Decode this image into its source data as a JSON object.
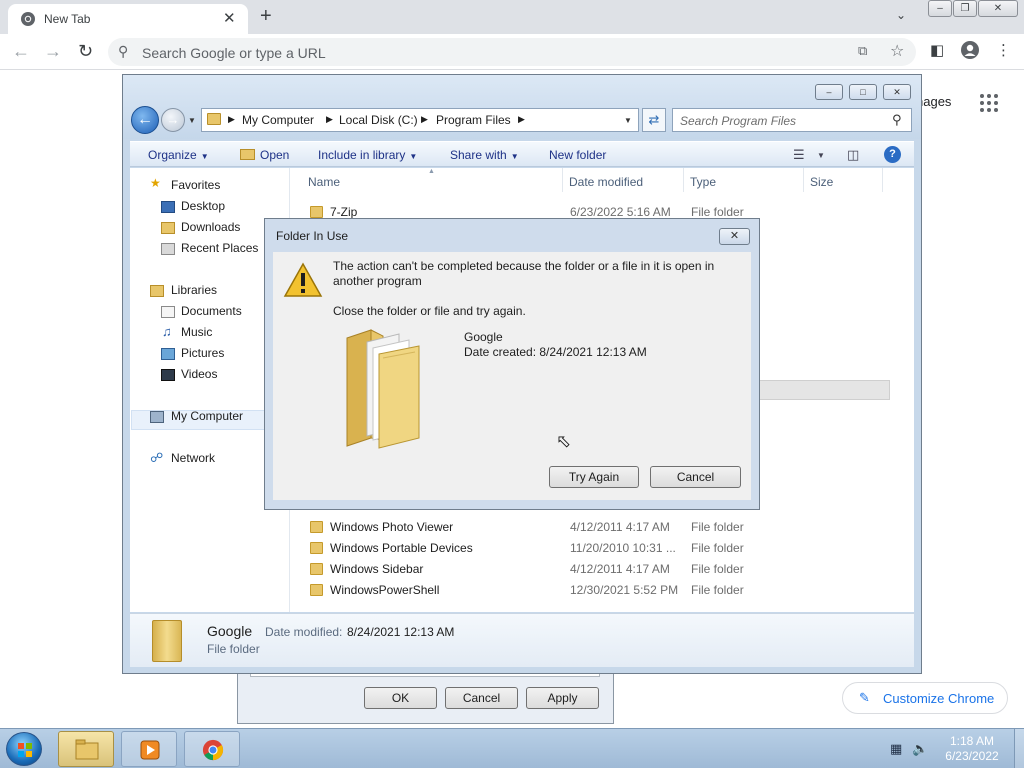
{
  "browser": {
    "tab_title": "New Tab",
    "tab_close": "✕",
    "new_tab": "+",
    "omnibox_placeholder": "Search Google or type a URL",
    "images_link": "nages",
    "customize_label": "Customize Chrome",
    "accent_color": "#1a73e8"
  },
  "background_dialog": {
    "ok": "OK",
    "cancel": "Cancel",
    "apply": "Apply"
  },
  "explorer": {
    "breadcrumbs": [
      "My Computer",
      "Local Disk (C:)",
      "Program Files"
    ],
    "search_placeholder": "Search Program Files",
    "commands": {
      "organize": "Organize",
      "open": "Open",
      "include_in_library": "Include in library",
      "share_with": "Share with",
      "new_folder": "New folder"
    },
    "nav": {
      "favorites": "Favorites",
      "desktop": "Desktop",
      "downloads": "Downloads",
      "recent_places": "Recent Places",
      "libraries": "Libraries",
      "documents": "Documents",
      "music": "Music",
      "pictures": "Pictures",
      "videos": "Videos",
      "my_computer": "My Computer",
      "network": "Network"
    },
    "columns": {
      "name": "Name",
      "date_modified": "Date modified",
      "type": "Type",
      "size": "Size"
    },
    "rows": [
      {
        "name": "7-Zip",
        "date": "6/23/2022 5:16 AM",
        "type": "File folder"
      },
      {
        "name": "Windows Photo Viewer",
        "date": "4/12/2011 4:17 AM",
        "type": "File folder"
      },
      {
        "name": "Windows Portable Devices",
        "date": "11/20/2010 10:31 ...",
        "type": "File folder"
      },
      {
        "name": "Windows Sidebar",
        "date": "4/12/2011 4:17 AM",
        "type": "File folder"
      },
      {
        "name": "WindowsPowerShell",
        "date": "12/30/2021 5:52 PM",
        "type": "File folder"
      }
    ],
    "details": {
      "name": "Google",
      "label": "Date modified:",
      "value": "8/24/2021 12:13 AM",
      "type": "File folder"
    }
  },
  "dialog": {
    "title": "Folder In Use",
    "message": "The action can't be completed because the folder or a file in it is open in another program",
    "instruction": "Close the folder or file and try again.",
    "folder_name": "Google",
    "folder_date": "Date created: 8/24/2021 12:13 AM",
    "try_again": "Try Again",
    "cancel": "Cancel"
  },
  "taskbar": {
    "time": "1:18 AM",
    "date": "6/23/2022"
  }
}
